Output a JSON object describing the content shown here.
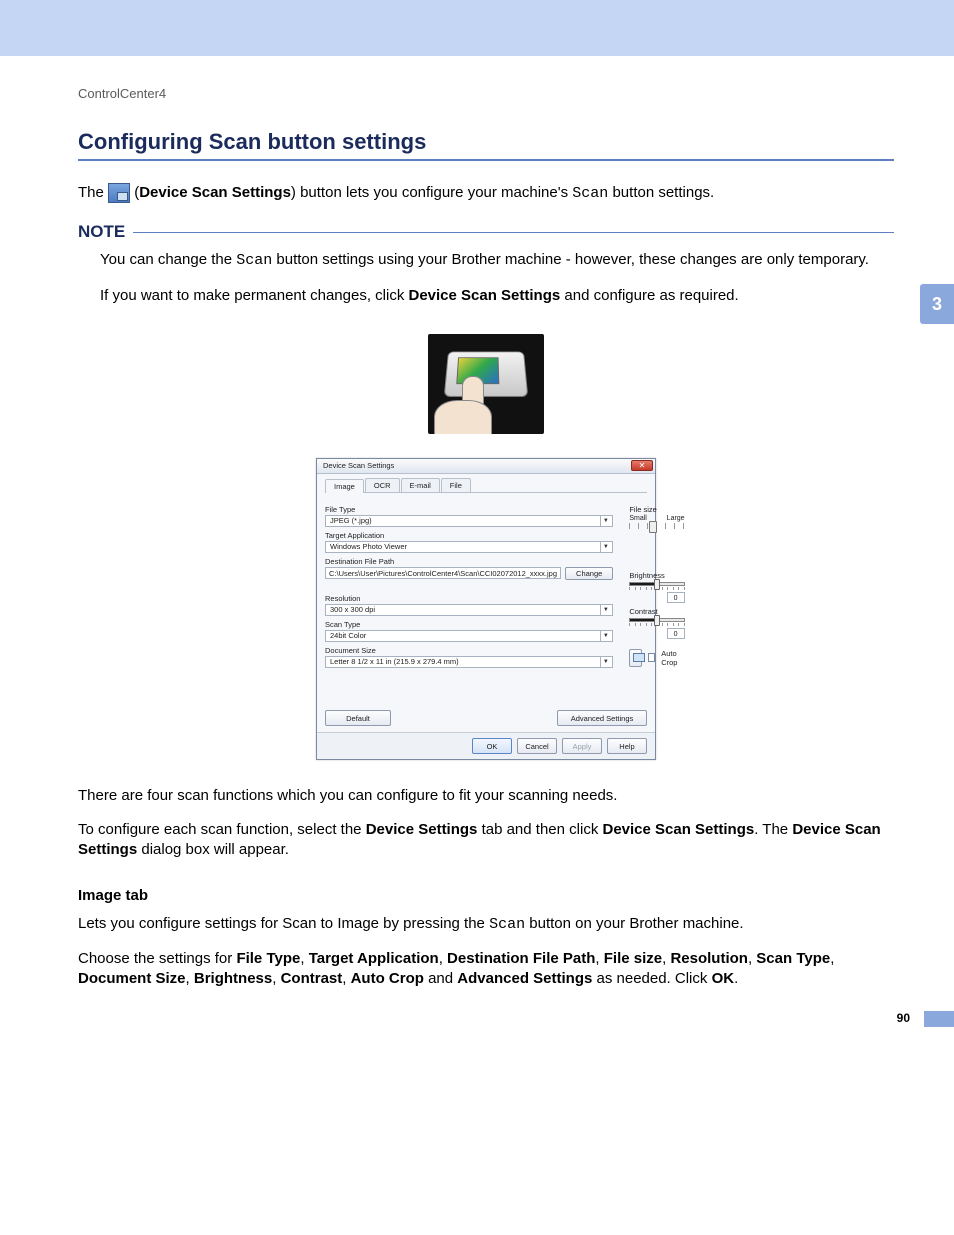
{
  "header": {
    "breadcrumb": "ControlCenter4"
  },
  "chapter_tab": "3",
  "page_number": "90",
  "title": "Configuring Scan button settings",
  "intro": {
    "prefix": "The ",
    "button_label": "Device Scan Settings",
    "middle": ") button lets you configure your machine's ",
    "code": "Scan",
    "suffix": " button settings."
  },
  "note": {
    "heading": "NOTE",
    "p1_a": "You can change the ",
    "p1_code": "Scan",
    "p1_b": " button settings using your Brother machine - however, these changes are only temporary.",
    "p2_a": "If you want to make permanent changes, click ",
    "p2_bold": "Device Scan Settings",
    "p2_b": " and configure as required."
  },
  "dialog": {
    "title": "Device Scan Settings",
    "close": "✕",
    "tabs": [
      "Image",
      "OCR",
      "E-mail",
      "File"
    ],
    "left": {
      "file_type_label": "File Type",
      "file_type_value": "JPEG (*.jpg)",
      "target_app_label": "Target Application",
      "target_app_value": "Windows Photo Viewer",
      "dest_label": "Destination File Path",
      "dest_value": "C:\\Users\\User\\Pictures\\ControlCenter4\\Scan\\CCI02072012_xxxx.jpg",
      "change_btn": "Change",
      "resolution_label": "Resolution",
      "resolution_value": "300 x 300 dpi",
      "scan_type_label": "Scan Type",
      "scan_type_value": "24bit Color",
      "doc_size_label": "Document Size",
      "doc_size_value": "Letter 8 1/2 x 11 in (215.9 x 279.4 mm)"
    },
    "right": {
      "file_size_label": "File size",
      "small": "Small",
      "large": "Large",
      "brightness_label": "Brightness",
      "brightness_value": "0",
      "contrast_label": "Contrast",
      "contrast_value": "0",
      "auto_crop": "Auto Crop"
    },
    "default_btn": "Default",
    "adv_btn": "Advanced Settings",
    "footer": {
      "ok": "OK",
      "cancel": "Cancel",
      "apply": "Apply",
      "help": "Help"
    }
  },
  "after1": "There are four scan functions which you can configure to fit your scanning needs.",
  "after2": {
    "a": "To configure each scan function, select the ",
    "b1": "Device Settings",
    "c": " tab and then click ",
    "b2": "Device Scan Settings",
    "d": ". The ",
    "b3": "Device Scan Settings",
    "e": " dialog box will appear."
  },
  "image_tab": {
    "title": "Image tab",
    "p1_a": "Lets you configure settings for Scan to Image by pressing the ",
    "p1_code": "Scan",
    "p1_b": " button on your Brother machine.",
    "p2_a": "Choose the settings for ",
    "bolds": [
      "File Type",
      "Target Application",
      "Destination File Path",
      "File size",
      "Resolution",
      "Scan Type",
      "Document Size",
      "Brightness",
      "Contrast",
      "Auto Crop",
      "Advanced Settings"
    ],
    "p2_b": " as needed. Click ",
    "ok": "OK",
    "p2_c": "."
  }
}
